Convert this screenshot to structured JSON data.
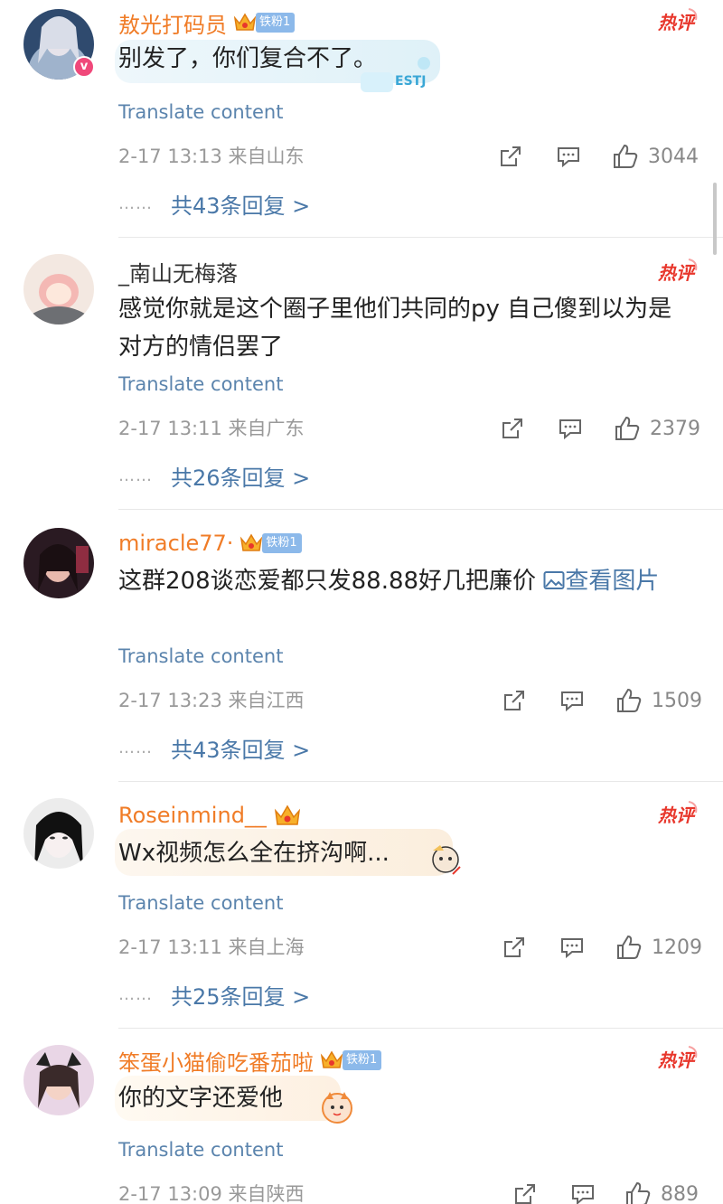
{
  "comments": [
    {
      "username": "敖光打码员",
      "fan_badge": "铁粉1",
      "hot_label": "热评",
      "content": "别发了，你们复合不了。",
      "sticker_text": "ESTJ",
      "translate_label": "Translate content",
      "time_location": "2-17 13:13  来自山东",
      "likes": "3044",
      "replies_label": "共43条回复 >"
    },
    {
      "username": "_南山无梅落",
      "hot_label": "热评",
      "content": "感觉你就是这个圈子里他们共同的py 自己傻到以为是对方的情侣罢了",
      "translate_label": "Translate content",
      "time_location": "2-17 13:11  来自广东",
      "likes": "2379",
      "replies_label": "共26条回复 >"
    },
    {
      "username": "miracle77·",
      "fan_badge": "铁粉1",
      "content": "这群208谈恋爱都只发88.88好几把廉价 ",
      "view_image_label": "查看图片",
      "translate_label": "Translate content",
      "time_location": "2-17 13:23  来自江西",
      "likes": "1509",
      "replies_label": "共43条回复 >"
    },
    {
      "username": "Roseinmind__",
      "hot_label": "热评",
      "content": "Wx视频怎么全在挤沟啊...",
      "translate_label": "Translate content",
      "time_location": "2-17 13:11  来自上海",
      "likes": "1209",
      "replies_label": "共25条回复 >"
    },
    {
      "username": "笨蛋小猫偷吃番茄啦",
      "fan_badge": "铁粉1",
      "hot_label": "热评",
      "content": "你的文字还爱他",
      "translate_label": "Translate content",
      "time_location": "2-17 13:09  来自陕西",
      "likes": "889"
    }
  ],
  "colors": {
    "username": "#f07c27",
    "link": "#4a78a8",
    "translate": "#5b84ad",
    "meta": "#999999",
    "hot": "#e8372c",
    "fan_badge": "#8cb9ea"
  },
  "icons": [
    "verified-v-icon",
    "crown-icon",
    "hot-comment-icon",
    "share-icon",
    "comment-icon",
    "like-icon",
    "image-icon"
  ]
}
